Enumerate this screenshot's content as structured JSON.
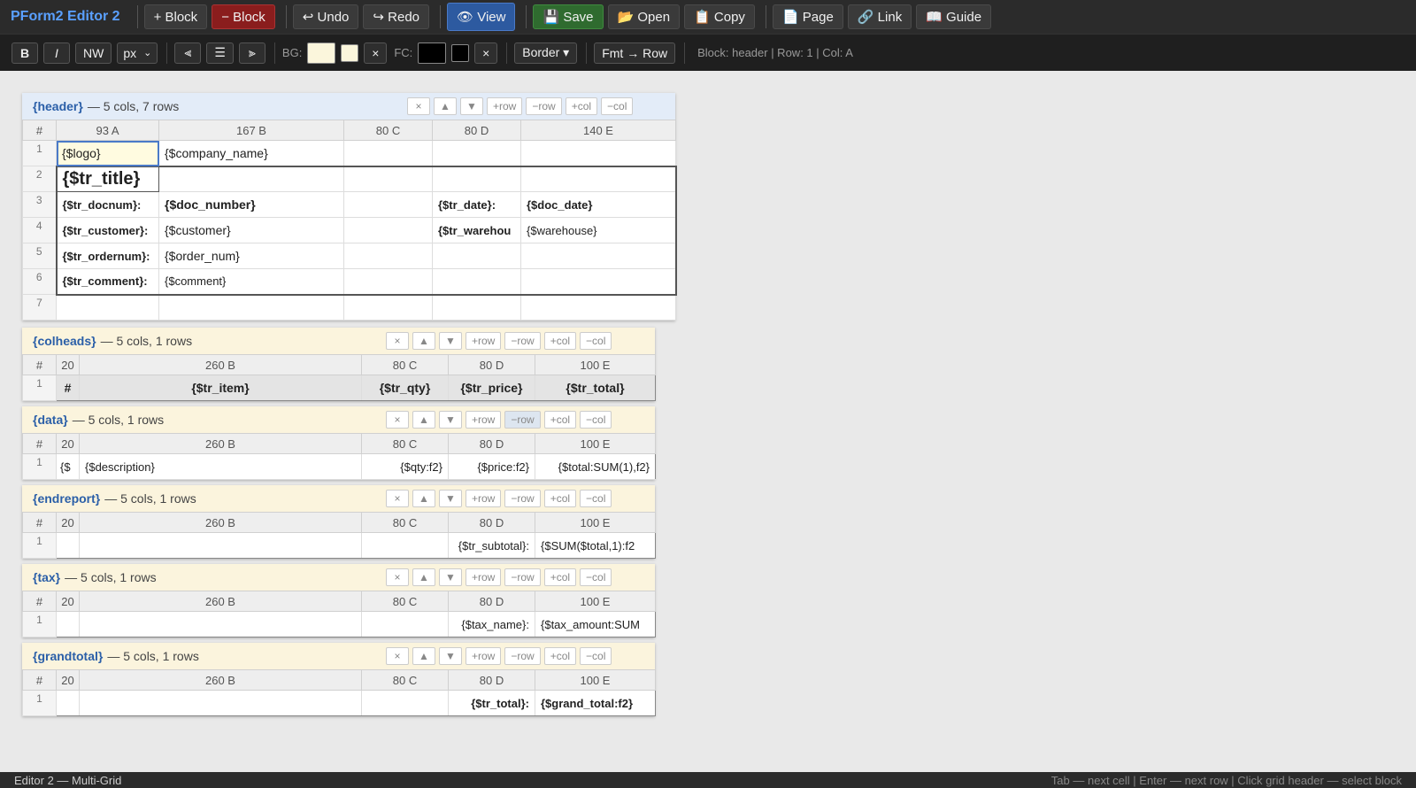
{
  "app": {
    "title": "PForm2 Editor 2"
  },
  "toolbar": {
    "add_block": "+ Block",
    "remove_block": "− Block",
    "undo": "↩ Undo",
    "redo": "↪ Redo",
    "view": "👁 View",
    "save": "💾 Save",
    "open": "📂 Open",
    "copy": "📋 Copy",
    "page": "📄 Page",
    "link": "🔗 Link",
    "guide": "📖 Guide"
  },
  "format": {
    "bold": "B",
    "italic": "I",
    "nowrap": "NW",
    "unit": "px",
    "align_left": "⫷",
    "align_center": "☰",
    "align_right": "⫸",
    "bg_label": "BG:",
    "fc_label": "FC:",
    "clear": "×",
    "border": "Border ▾",
    "fmt_row": "Fmt → Row",
    "status": "Block: header | Row: 1 | Col: A",
    "bg_color": "#fbf6dc",
    "fc_color": "#000000"
  },
  "controls": {
    "close": "×",
    "up": "▲",
    "down": "▼",
    "add_row": "+row",
    "del_row": "−row",
    "add_col": "+col",
    "del_col": "−col"
  },
  "blocks": {
    "header": {
      "name": "{header}",
      "info": "— 5 cols, 7 rows",
      "cols": [
        "#",
        "93 A",
        "167 B",
        "80 C",
        "80 D",
        "140 E"
      ],
      "rows": [
        [
          "1",
          "{$logo}",
          "{$company_name}",
          "",
          "",
          ""
        ],
        [
          "2",
          "{$tr_title}",
          "",
          "",
          "",
          ""
        ],
        [
          "3",
          "{$tr_docnum}:",
          "{$doc_number}",
          "",
          "{$tr_date}:",
          "{$doc_date}"
        ],
        [
          "4",
          "{$tr_customer}:",
          "{$customer}",
          "",
          "{$tr_warehou",
          "{$warehouse}"
        ],
        [
          "5",
          "{$tr_ordernum}:",
          "{$order_num}",
          "",
          "",
          ""
        ],
        [
          "6",
          "{$tr_comment}:",
          "{$comment}",
          "",
          "",
          ""
        ],
        [
          "7",
          "",
          "",
          "",
          "",
          ""
        ]
      ]
    },
    "colheads": {
      "name": "{colheads}",
      "info": "— 5 cols, 1 rows",
      "cols": [
        "#",
        "20",
        "260 B",
        "80 C",
        "80 D",
        "100 E"
      ],
      "rows": [
        [
          "1",
          "#",
          "{$tr_item}",
          "{$tr_qty}",
          "{$tr_price}",
          "{$tr_total}"
        ]
      ]
    },
    "data": {
      "name": "{data}",
      "info": "— 5 cols, 1 rows",
      "cols": [
        "#",
        "20",
        "260 B",
        "80 C",
        "80 D",
        "100 E"
      ],
      "rows": [
        [
          "1",
          "{$",
          "{$description}",
          "{$qty:f2}",
          "{$price:f2}",
          "{$total:SUM(1),f2}"
        ]
      ]
    },
    "endreport": {
      "name": "{endreport}",
      "info": "— 5 cols, 1 rows",
      "cols": [
        "#",
        "20",
        "260 B",
        "80 C",
        "80 D",
        "100 E"
      ],
      "rows": [
        [
          "1",
          "",
          "",
          "",
          "{$tr_subtotal}:",
          "{$SUM($total,1):f2"
        ]
      ]
    },
    "tax": {
      "name": "{tax}",
      "info": "— 5 cols, 1 rows",
      "cols": [
        "#",
        "20",
        "260 B",
        "80 C",
        "80 D",
        "100 E"
      ],
      "rows": [
        [
          "1",
          "",
          "",
          "",
          "{$tax_name}:",
          "{$tax_amount:SUM"
        ]
      ]
    },
    "grandtotal": {
      "name": "{grandtotal}",
      "info": "— 5 cols, 1 rows",
      "cols": [
        "#",
        "20",
        "260 B",
        "80 C",
        "80 D",
        "100 E"
      ],
      "rows": [
        [
          "1",
          "",
          "",
          "",
          "{$tr_total}:",
          "{$grand_total:f2}"
        ]
      ]
    }
  },
  "footer": {
    "left": "Editor 2 — Multi-Grid",
    "hint": "Tab — next cell | Enter — next row | Click grid header — select block"
  }
}
